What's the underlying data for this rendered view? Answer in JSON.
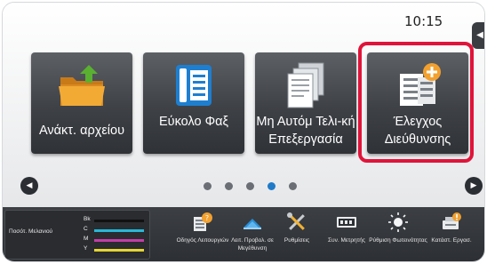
{
  "status": {
    "time": "10:15"
  },
  "tiles": [
    {
      "label": "Ανάκτ. αρχείου",
      "icon": "folder-upload-icon"
    },
    {
      "label": "Εύκολο Φαξ",
      "icon": "fax-icon"
    },
    {
      "label": "Μη Αυτόμ Τελι-κή Επεξεργασία",
      "icon": "document-stack-icon"
    },
    {
      "label": "Έλεγχος Διεύθυνσης",
      "icon": "address-add-icon",
      "highlighted": true
    }
  ],
  "pager": {
    "pages": 5,
    "active_index": 3
  },
  "toner": {
    "title": "Ποσότ. Μελανιού",
    "rows": [
      {
        "label": "Bk",
        "color": "#111111",
        "level": 1.0
      },
      {
        "label": "C",
        "color": "#27b8d8",
        "level": 1.0
      },
      {
        "label": "M",
        "color": "#c43da7",
        "level": 1.0
      },
      {
        "label": "Y",
        "color": "#e6d533",
        "level": 1.0
      }
    ]
  },
  "taskbar": [
    {
      "label": "Οδηγός Λειτουργιών",
      "icon": "operation-guide-icon"
    },
    {
      "label": "Λειτ. Προβολ. σε Μεγέθυνση",
      "icon": "magnify-icon"
    },
    {
      "label": "Ρυθμίσεις",
      "icon": "settings-tools-icon"
    },
    {
      "label": "Συν. Μετρητής",
      "icon": "counter-icon"
    },
    {
      "label": "Ρύθμιση Φωτεινότητας",
      "icon": "brightness-icon"
    },
    {
      "label": "Κατάστ. Εργασ.",
      "icon": "job-status-icon"
    }
  ],
  "colors": {
    "highlight": "#e0143a",
    "accent": "#1f7ac8",
    "folder": "#f0a430",
    "tile_green": "#5ab031"
  }
}
